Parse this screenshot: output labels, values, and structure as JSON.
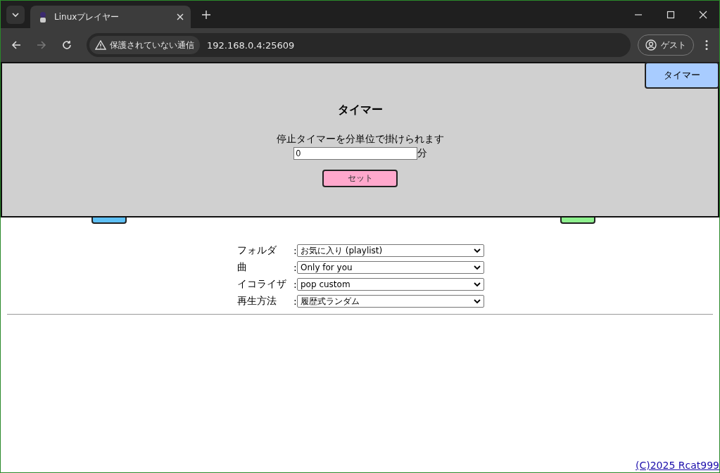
{
  "browser": {
    "tab_title": "Linuxプレイヤー",
    "security_label": "保護されていない通信",
    "address": "192.168.0.4:25609",
    "profile": "ゲスト"
  },
  "timer_button": "タイマー",
  "timer_dialog": {
    "title": "タイマー",
    "description": "停止タイマーを分単位で掛けられます",
    "minutes_value": "0",
    "unit": "分",
    "set_button": "セット"
  },
  "controls": [
    {
      "label": "フォルダ",
      "separator": ":",
      "value": "お気に入り (playlist)"
    },
    {
      "label": "曲",
      "separator": ":",
      "value": "Only for you"
    },
    {
      "label": "イコライザ",
      "separator": ":",
      "value": "pop custom"
    },
    {
      "label": "再生方法",
      "separator": ":",
      "value": "履歴式ランダム"
    }
  ],
  "footer_link": "(C)2025 Rcat999"
}
